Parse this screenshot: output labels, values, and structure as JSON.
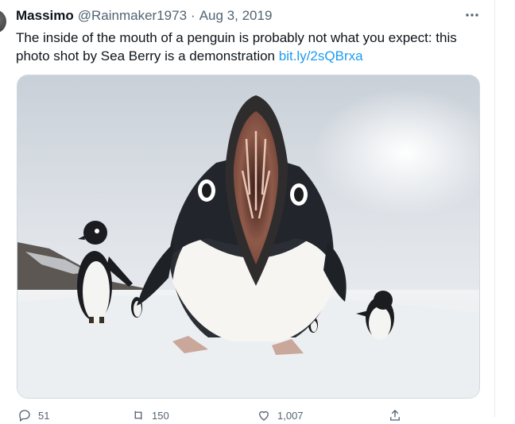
{
  "tweet": {
    "author_name": "Massimo",
    "author_handle": "@Rainmaker1973",
    "separator": "·",
    "date": "Aug 3, 2019",
    "text_before_link": "The inside of the mouth of a penguin is probably not what you expect: this photo shot by Sea Berry is a demonstration ",
    "link_text": "bit.ly/2sQBrxa",
    "more_icon": "more-icon"
  },
  "actions": {
    "reply_count": "51",
    "retweet_count": "150",
    "like_count": "1,007"
  },
  "colors": {
    "text": "#0f1419",
    "muted": "#536471",
    "link": "#1d9bf0",
    "border": "#cfd9de"
  }
}
